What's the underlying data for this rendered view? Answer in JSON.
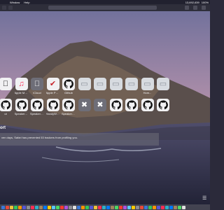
{
  "menubar": {
    "items": [
      "Window",
      "Help"
    ],
    "status": [
      "13,692,639",
      "100%"
    ]
  },
  "toolbar": {
    "address": ""
  },
  "favorites_row1": [
    {
      "label": "",
      "icon": "apple-icon",
      "style": "paper"
    },
    {
      "label": "Apple Ma...ok",
      "icon": "music-note-icon",
      "style": "paper"
    },
    {
      "label": "iCloud",
      "icon": "apple-icon",
      "style": "gray"
    },
    {
      "label": "Apple Photo...",
      "icon": "checkmark-shield-icon",
      "style": "paper"
    },
    {
      "label": "Github",
      "icon": "github-icon",
      "style": "paper"
    },
    {
      "label": "",
      "icon": "laptop-icon",
      "style": "light"
    },
    {
      "label": "",
      "icon": "laptop-icon",
      "style": "light"
    },
    {
      "label": "",
      "icon": "laptop-icon",
      "style": "light"
    },
    {
      "label": "",
      "icon": "laptop-icon",
      "style": "light"
    },
    {
      "label": "Hom...",
      "icon": "laptop-icon",
      "style": "light"
    },
    {
      "label": "",
      "icon": "laptop-icon",
      "style": "light"
    }
  ],
  "favorites_row2": [
    {
      "label": "ut",
      "icon": "github-icon",
      "style": "paper"
    },
    {
      "label": "Speakers (Hydrid...",
      "icon": "github-icon",
      "style": "paper"
    },
    {
      "label": "Speakers (Hydrid...",
      "icon": "github-icon",
      "style": "paper"
    },
    {
      "label": "HandyWo...ePoker",
      "icon": "github-icon",
      "style": "paper"
    },
    {
      "label": "Speakers (Hydrid...",
      "icon": "github-icon",
      "style": "paper"
    },
    {
      "label": "",
      "icon": "x-icon",
      "style": "gray"
    },
    {
      "label": "",
      "icon": "x-icon",
      "style": "gray"
    },
    {
      "label": "",
      "icon": "github-icon",
      "style": "paper"
    },
    {
      "label": "",
      "icon": "github-icon",
      "style": "paper"
    },
    {
      "label": "",
      "icon": "github-icon",
      "style": "paper"
    },
    {
      "label": "",
      "icon": "github-icon",
      "style": "paper"
    }
  ],
  "report": {
    "heading": "ort",
    "privacy_text": "ven days, Safari has prevented 53 trackers from profiling you."
  },
  "dock": {
    "colors": [
      "#3a78d8",
      "#e94a3a",
      "#f0c23a",
      "#34c759",
      "#ff9500",
      "#5856d6",
      "#8e8e93",
      "#ff2d55",
      "#30b0c7",
      "#a2845e",
      "#007aff",
      "#ffcc00",
      "#5ac8fa",
      "#4cd964",
      "#ff3b30",
      "#af52de",
      "#8e8e93",
      "#e0e0e0",
      "#3a78d8",
      "#ff9500",
      "#34c759",
      "#5856d6",
      "#f0c23a",
      "#ff2d55",
      "#30b0c7",
      "#007aff",
      "#a2845e",
      "#4cd964",
      "#ff3b30",
      "#af52de",
      "#5ac8fa",
      "#ffcc00",
      "#8e8e93",
      "#e94a3a",
      "#3a78d8",
      "#34c759",
      "#ff9500",
      "#5856d6",
      "#ff2d55",
      "#30b0c7",
      "#007aff",
      "#a2845e",
      "#4cd964",
      "#e0e0e0"
    ]
  }
}
